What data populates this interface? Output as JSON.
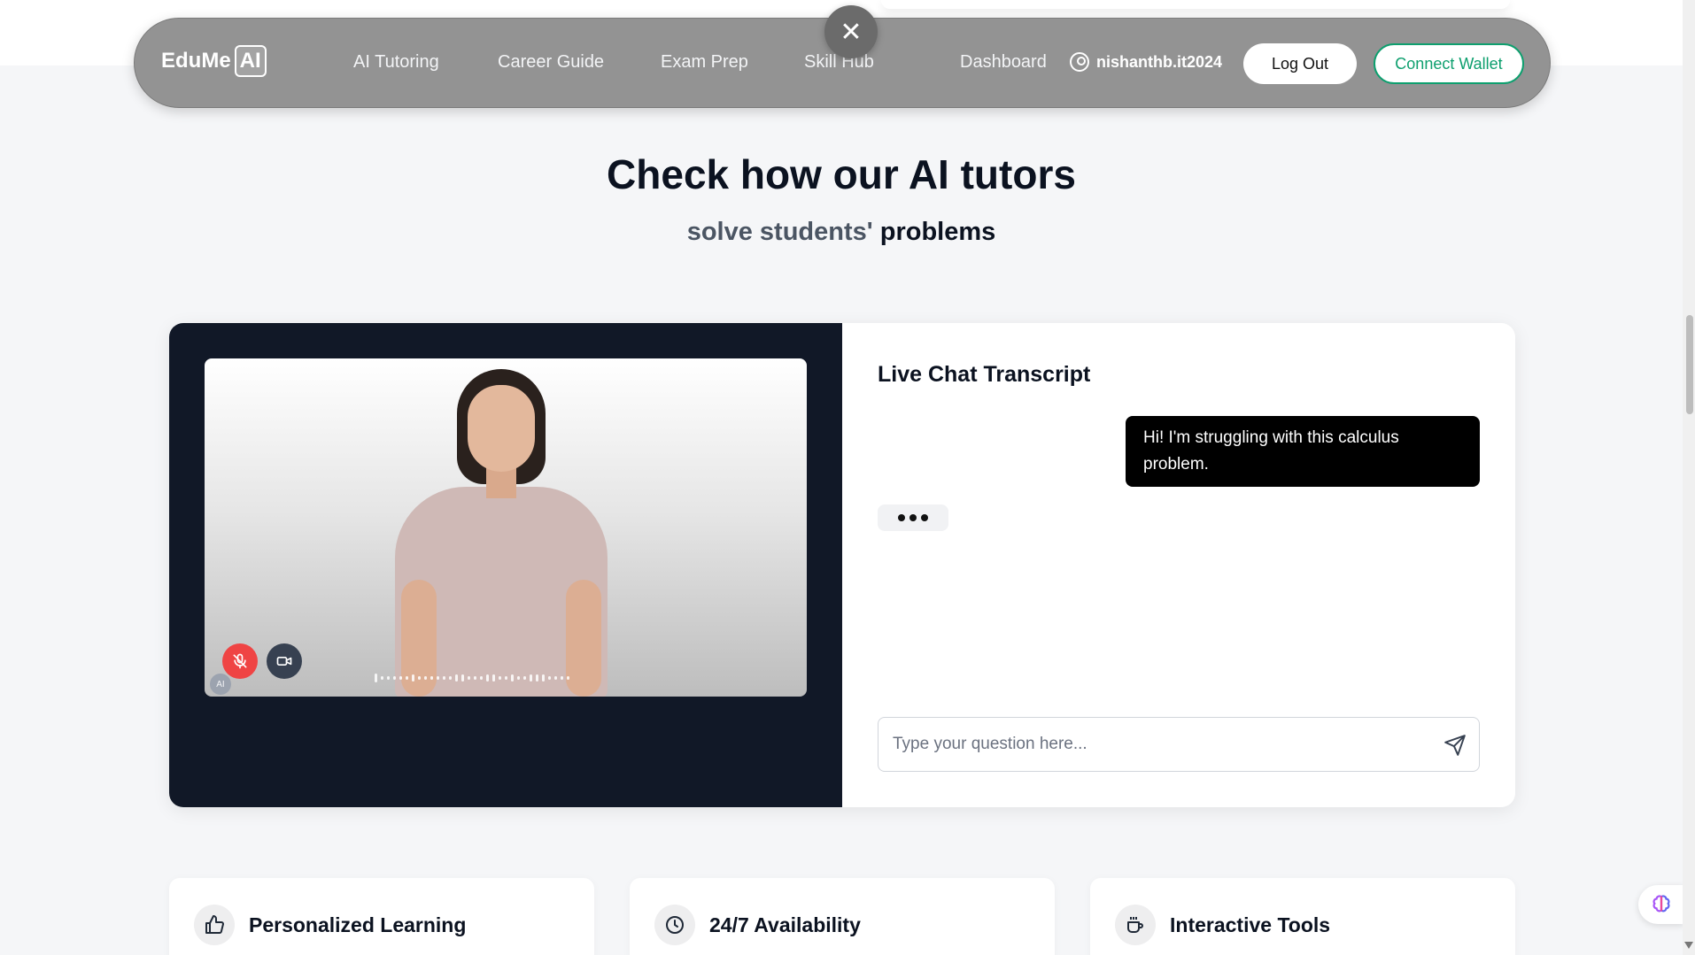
{
  "navbar": {
    "logo_text": "EduMe",
    "logo_badge": "AI",
    "links": [
      "AI Tutoring",
      "Career Guide",
      "Exam Prep",
      "Skill Hub"
    ],
    "dashboard": "Dashboard",
    "username": "nishanthb.it2024",
    "logout_label": "Log Out",
    "wallet_label": "Connect Wallet"
  },
  "close_button_symbol": "✕",
  "hero": {
    "title": "Check how our AI tutors",
    "subtitle_muted": "solve students'",
    "subtitle_strong": "problems"
  },
  "video": {
    "ai_badge": "AI",
    "icons": [
      "mic-off-icon",
      "video-camera-icon"
    ],
    "mic_color": "#ef4444"
  },
  "chat": {
    "title": "Live Chat Transcript",
    "messages": [
      {
        "role": "user",
        "text": "Hi! I'm struggling with this calculus problem."
      }
    ],
    "typing_indicator": true,
    "input_placeholder": "Type your question here...",
    "send_icon": "send-icon"
  },
  "features": [
    {
      "title": "Personalized Learning",
      "icon": "thumbs-up-icon"
    },
    {
      "title": "24/7 Availability",
      "icon": "clock-icon"
    },
    {
      "title": "Interactive Tools",
      "icon": "coffee-cup-icon"
    }
  ],
  "colors": {
    "navbar_bg": "#939393",
    "wallet_accent": "#0d9f6e",
    "video_panel_bg": "#111827",
    "user_bubble_bg": "#000000"
  }
}
